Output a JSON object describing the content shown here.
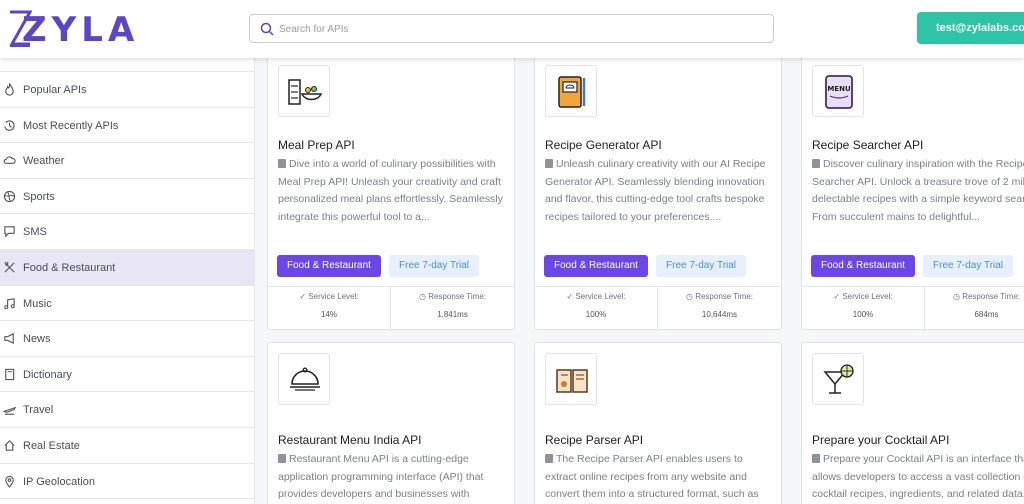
{
  "header": {
    "logo_text": "ZYLA",
    "search": {
      "placeholder": "Search for APIs",
      "value": ""
    },
    "user_email": "test@zylalabs.com"
  },
  "sidebar": {
    "items": [
      {
        "label": "Popular APIs",
        "icon": "fire-icon"
      },
      {
        "label": "Most Recently APIs",
        "icon": "history-icon"
      },
      {
        "label": "Weather",
        "icon": "cloud-icon"
      },
      {
        "label": "Sports",
        "icon": "ball-icon"
      },
      {
        "label": "SMS",
        "icon": "message-icon"
      },
      {
        "label": "Food & Restaurant",
        "icon": "utensils-icon",
        "active": true
      },
      {
        "label": "Music",
        "icon": "music-icon"
      },
      {
        "label": "News",
        "icon": "megaphone-icon"
      },
      {
        "label": "Dictionary",
        "icon": "book-icon"
      },
      {
        "label": "Travel",
        "icon": "plane-icon"
      },
      {
        "label": "Real Estate",
        "icon": "house-icon"
      },
      {
        "label": "IP Geolocation",
        "icon": "location-icon"
      }
    ]
  },
  "cards": [
    {
      "title": "Meal Prep API",
      "icon": "meal-prep-icon",
      "description": "Dive into a world of culinary possibilities with Meal Prep API! Unleash your creativity and craft personalized meal plans effortlessly. Seamlessly integrate this powerful tool to a...",
      "category": "Food & Restaurant",
      "trial": "Free 7-day Trial",
      "service_level_label": "Service Level:",
      "service_level": "14%",
      "response_time_label": "Response Time:",
      "response_time": "1,841ms"
    },
    {
      "title": "Recipe Generator API",
      "icon": "recipe-book-icon",
      "description": "Unleash culinary creativity with our AI Recipe Generator API. Seamlessly blending innovation and flavor, this cutting-edge tool crafts bespoke recipes tailored to your preferences....",
      "category": "Food & Restaurant",
      "trial": "Free 7-day Trial",
      "service_level_label": "Service Level:",
      "service_level": "100%",
      "response_time_label": "Response Time:",
      "response_time": "10,644ms"
    },
    {
      "title": "Recipe Searcher API",
      "icon": "menu-card-icon",
      "description": "Discover culinary inspiration with the Recipe Searcher API. Unlock a treasure trove of 2 million delectable recipes with a simple keyword search. From succulent mains to delightful...",
      "category": "Food & Restaurant",
      "trial": "Free 7-day Trial",
      "service_level_label": "Service Level:",
      "service_level": "100%",
      "response_time_label": "Response Time:",
      "response_time": "684ms"
    },
    {
      "title": "Restaurant Menu India API",
      "icon": "cloche-icon",
      "description": "Restaurant Menu API is a cutting-edge application programming interface (API) that provides developers and businesses with"
    },
    {
      "title": "Recipe Parser API",
      "icon": "open-recipe-book-icon",
      "description": "The Recipe Parser API enables users to extract online recipes from any website and convert them into a structured format, such as JSON. With this"
    },
    {
      "title": "Prepare your Cocktail API",
      "icon": "cocktail-icon",
      "description": "Prepare your Cocktail API is an interface that allows developers to access a vast collection of cocktail recipes, ingredients, and related data."
    }
  ],
  "colors": {
    "brand": "#5b46c7",
    "accent_teal": "#2ec4a6",
    "category_tag": "#6c47e8",
    "trial_tag_bg": "#e7f0fb",
    "trial_tag_text": "#4a8fd6"
  }
}
